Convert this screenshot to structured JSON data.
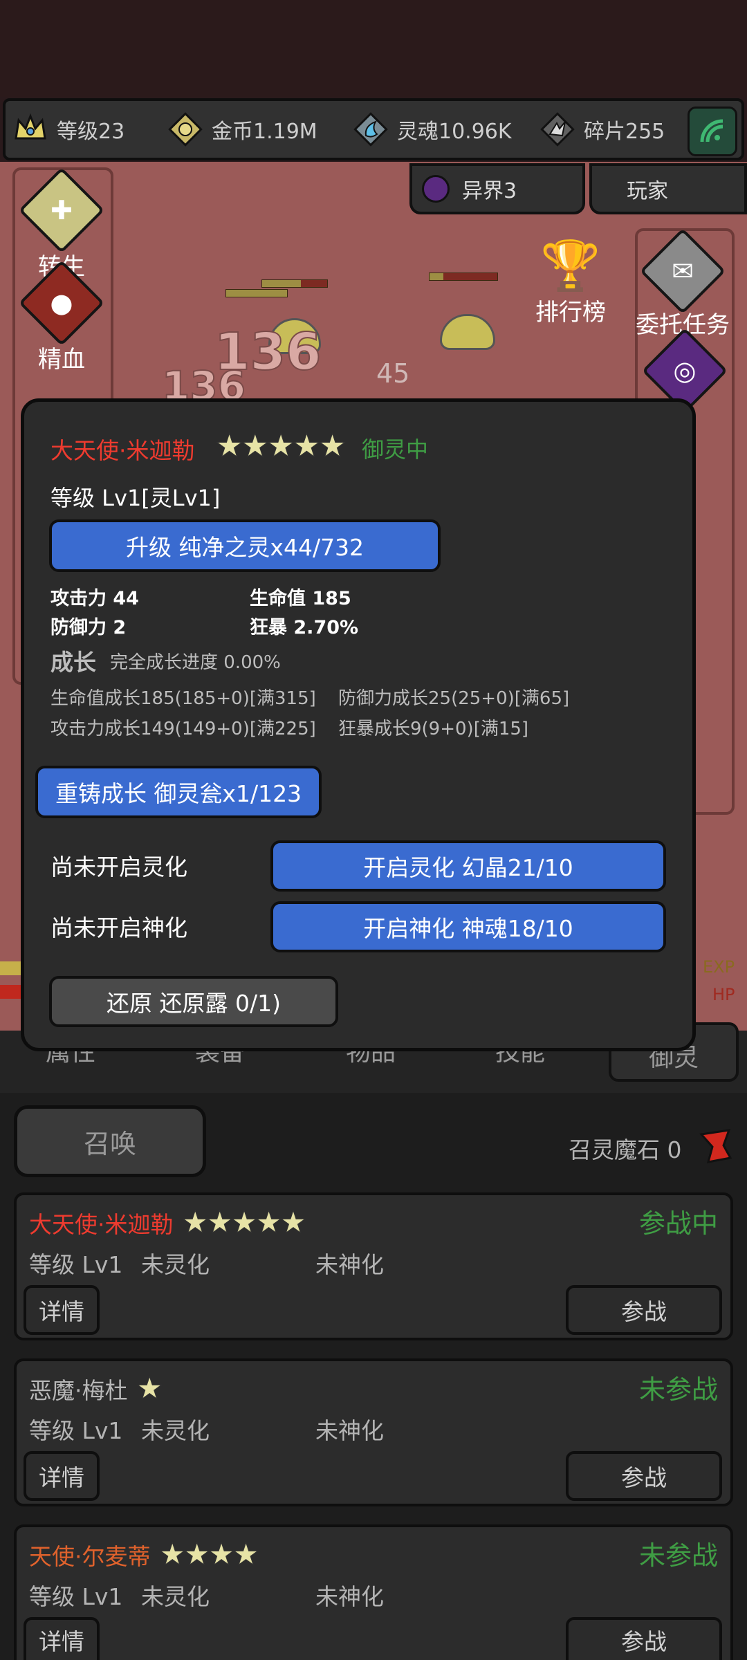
{
  "colors": {
    "accent_blue": "#3a6bd0",
    "name_red": "#ee3b2f",
    "status_green": "#3f9d44",
    "name_orange": "#e0622c"
  },
  "resources": {
    "level": {
      "label": "等级23",
      "icon": "crown-icon"
    },
    "gold": {
      "label": "金币1.19M",
      "icon": "coin-icon"
    },
    "soul": {
      "label": "灵魂10.96K",
      "icon": "soul-icon"
    },
    "shards": {
      "label": "碎片255",
      "icon": "shard-icon"
    }
  },
  "scene": {
    "world_tab": "异界3",
    "player_tab": "玩家",
    "left_buttons": [
      "转生",
      "精血"
    ],
    "ranking": "排行榜",
    "quest": "委托任务",
    "summon_side": "召唤",
    "damage_numbers": [
      "136",
      "136",
      "45",
      "45"
    ],
    "exp_label": "EXP",
    "hp_label": "HP"
  },
  "tabs": [
    "属性",
    "装备",
    "物品",
    "技能",
    "御灵"
  ],
  "dialog": {
    "name": "大天使·米迦勒",
    "stars": "★★★★★",
    "state": "御灵中",
    "level": "等级 Lv1[灵Lv1]",
    "upgrade_btn": "升级 纯净之灵x44/732",
    "stats": {
      "atk": "攻击力 44",
      "hp": "生命值 185",
      "def": "防御力 2",
      "crit": "狂暴 2.70%"
    },
    "growth_title": "成长",
    "growth_progress": "完全成长进度 0.00%",
    "growth": {
      "hp": "生命值成长185(185+0)[满315]",
      "def": "防御力成长25(25+0)[满65]",
      "atk": "攻击力成长149(149+0)[满225]",
      "crit": "狂暴成长9(9+0)[满15]"
    },
    "recast_btn": "重铸成长 御灵瓮x1/123",
    "spirit_status": "尚未开启灵化",
    "spirit_btn": "开启灵化 幻晶21/10",
    "divine_status": "尚未开启神化",
    "divine_btn": "开启神化 神魂18/10",
    "restore_btn": "还原 还原露 0/1)"
  },
  "bottom": {
    "summon_btn": "召唤",
    "stone_label": "召灵魔石 0",
    "cards": [
      {
        "name": "大天使·米迦勒",
        "stars": "★★★★★",
        "status": "参战中",
        "level": "等级 Lv1",
        "spirit": "未灵化",
        "divine": "未神化",
        "detail": "详情",
        "join": "参战"
      },
      {
        "name": "恶魔·梅杜",
        "stars": "★",
        "status": "未参战",
        "level": "等级 Lv1",
        "spirit": "未灵化",
        "divine": "未神化",
        "detail": "详情",
        "join": "参战"
      },
      {
        "name": "天使·尔麦蒂",
        "stars": "★★★★",
        "status": "未参战",
        "level": "等级 Lv1",
        "spirit": "未灵化",
        "divine": "未神化",
        "detail": "详情",
        "join": "参战"
      }
    ]
  }
}
